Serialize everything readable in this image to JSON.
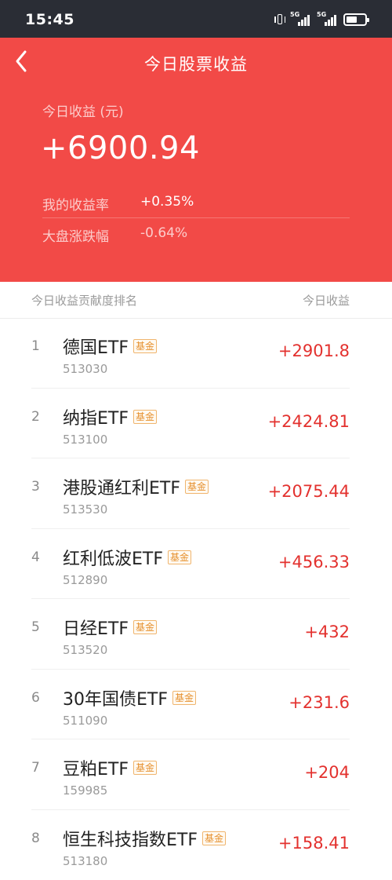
{
  "status_bar": {
    "time": "15:45",
    "network_1": "5G",
    "network_2": "5G",
    "icons": [
      "vibrate-icon",
      "signal-icon",
      "signal-icon",
      "battery-icon"
    ]
  },
  "header": {
    "title": "今日股票收益",
    "earnings_label": "今日收益 (元)",
    "earnings_value": "+6900.94",
    "rate_label": "我的收益率",
    "rate_value": "+0.35%",
    "market_label": "大盘涨跌幅",
    "market_value": "-0.64%"
  },
  "list": {
    "left_header": "今日收益贡献度排名",
    "right_header": "今日收益",
    "rows": [
      {
        "rank": "1",
        "name": "德国ETF",
        "badge": "基金",
        "code": "513030",
        "amount": "+2901.8"
      },
      {
        "rank": "2",
        "name": "纳指ETF",
        "badge": "基金",
        "code": "513100",
        "amount": "+2424.81"
      },
      {
        "rank": "3",
        "name": "港股通红利ETF",
        "badge": "基金",
        "code": "513530",
        "amount": "+2075.44"
      },
      {
        "rank": "4",
        "name": "红利低波ETF",
        "badge": "基金",
        "code": "512890",
        "amount": "+456.33"
      },
      {
        "rank": "5",
        "name": "日经ETF",
        "badge": "基金",
        "code": "513520",
        "amount": "+432"
      },
      {
        "rank": "6",
        "name": "30年国债ETF",
        "badge": "基金",
        "code": "511090",
        "amount": "+231.6"
      },
      {
        "rank": "7",
        "name": "豆粕ETF",
        "badge": "基金",
        "code": "159985",
        "amount": "+204"
      },
      {
        "rank": "8",
        "name": "恒生科技指数ETF",
        "badge": "基金",
        "code": "513180",
        "amount": "+158.41"
      }
    ]
  },
  "colors": {
    "header_bg": "#f24a47",
    "status_bar_bg": "#2a2d35",
    "gain_red": "#e3312e",
    "badge_orange": "#e6902e"
  }
}
